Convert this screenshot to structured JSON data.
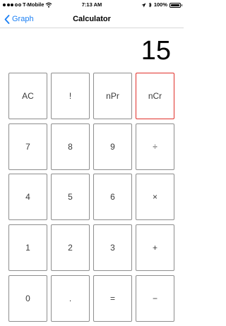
{
  "status_bar": {
    "carrier": "T-Mobile",
    "time": "7:13 AM",
    "battery": "100%",
    "signal_bars_filled": 3,
    "signal_bars_total": 5
  },
  "nav": {
    "back_label": "Graph",
    "title": "Calculator"
  },
  "display": {
    "value": "15"
  },
  "keypad": {
    "rows": [
      [
        "AC",
        "!",
        "nPr",
        "nCr"
      ],
      [
        "7",
        "8",
        "9",
        "÷"
      ],
      [
        "4",
        "5",
        "6",
        "×"
      ],
      [
        "1",
        "2",
        "3",
        "+"
      ],
      [
        "0",
        ".",
        "=",
        "−"
      ]
    ],
    "highlighted_key": "nCr",
    "highlight_color": "#e0302a"
  },
  "colors": {
    "accent": "#1a7ff4"
  }
}
